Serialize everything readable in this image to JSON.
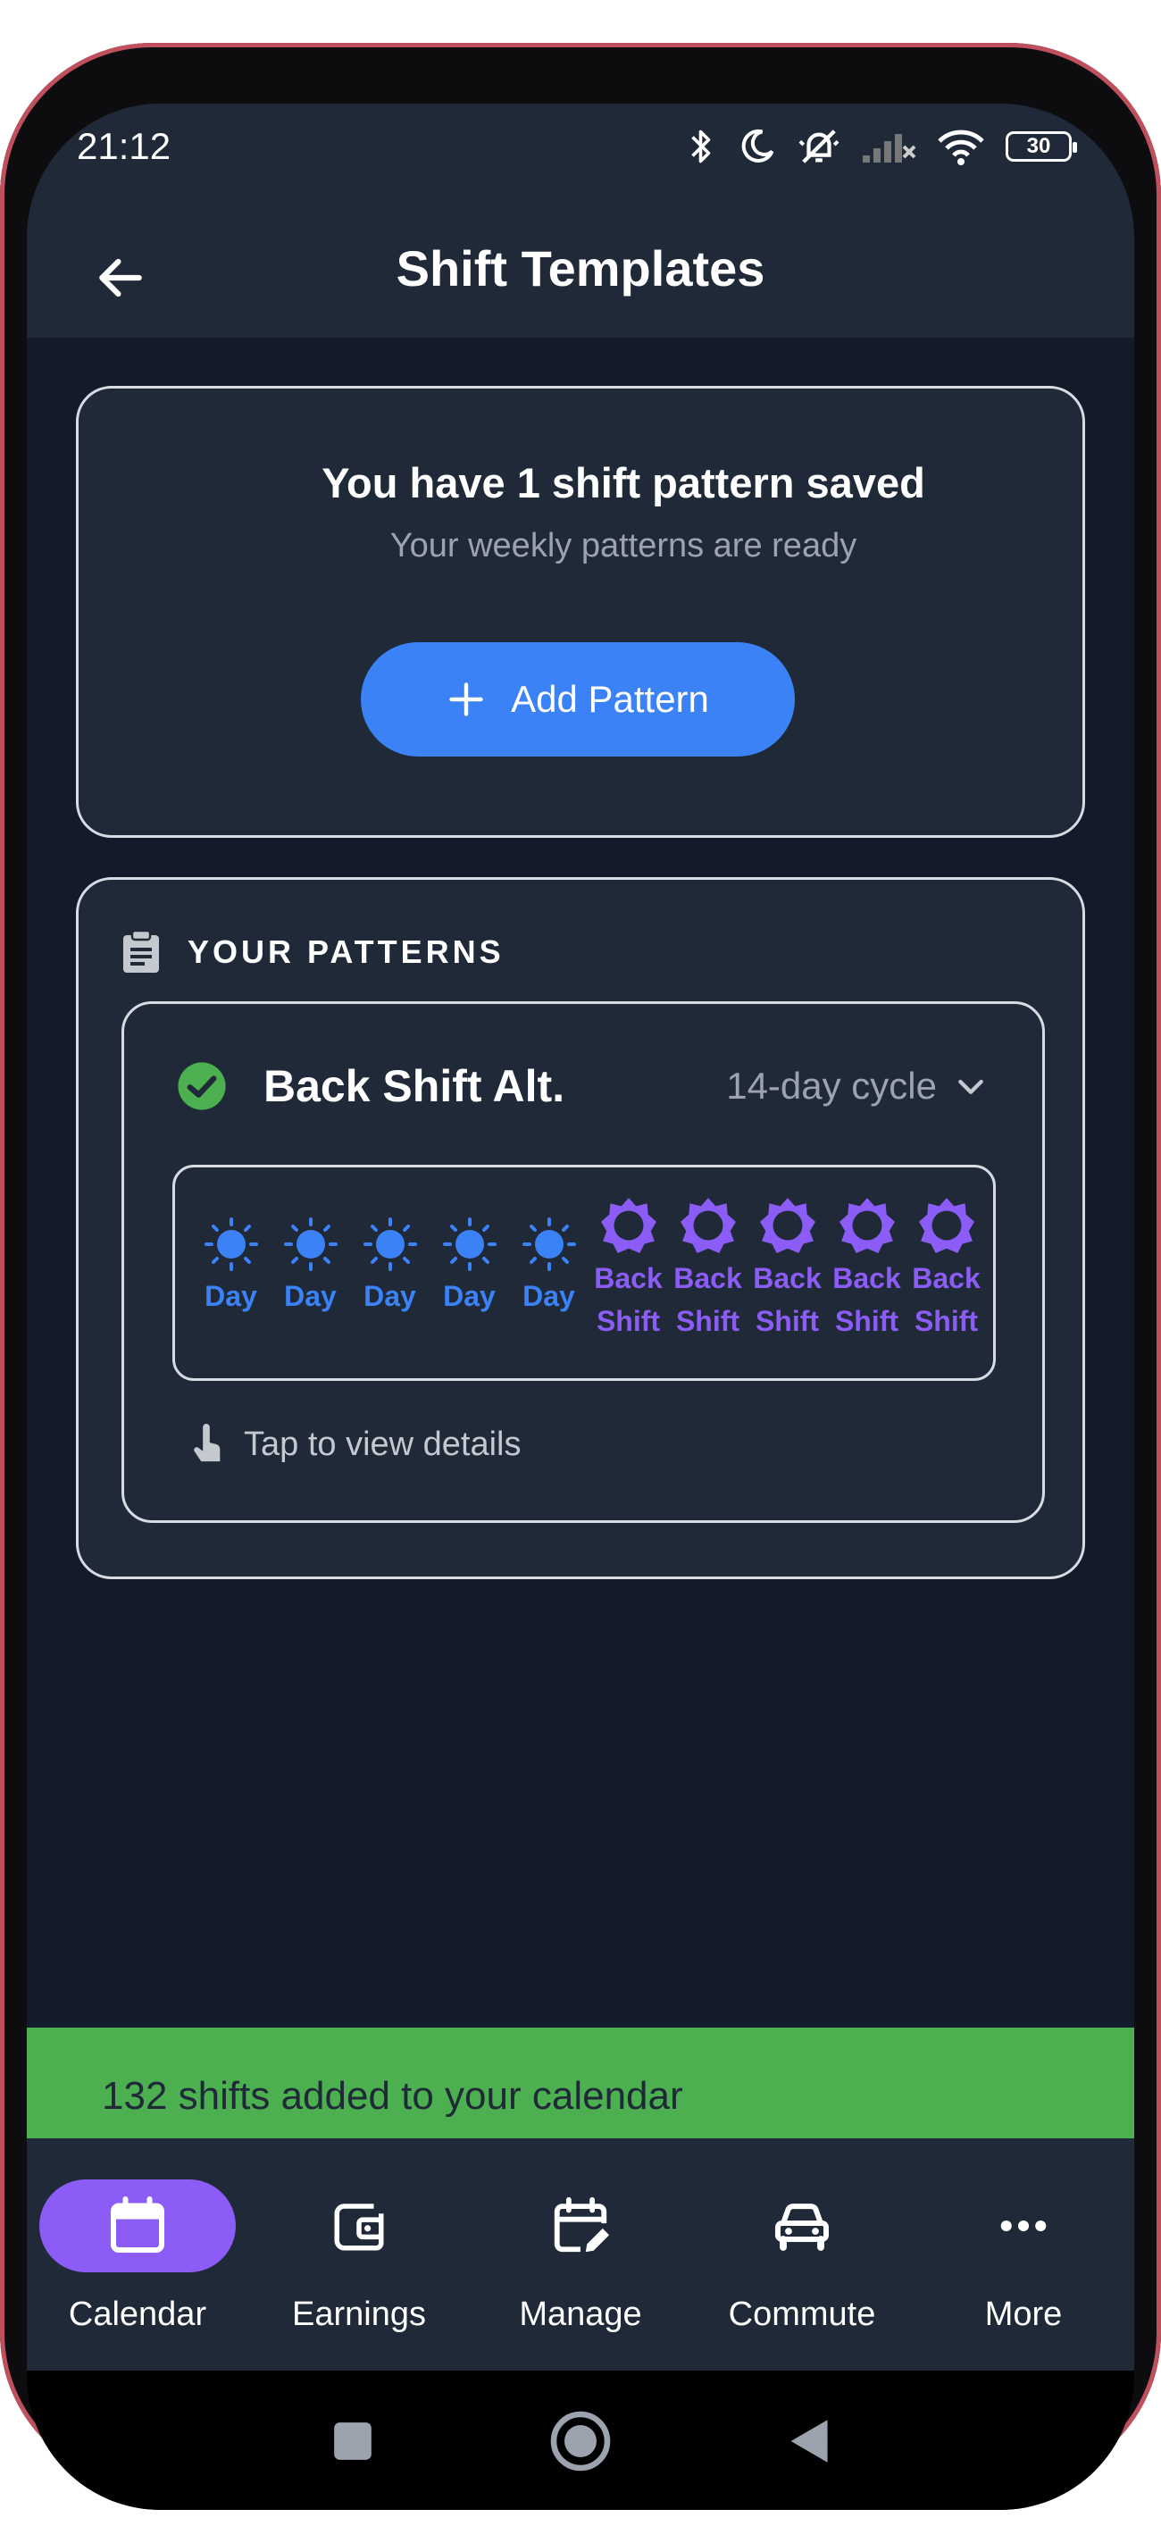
{
  "status_bar": {
    "time": "21:12",
    "battery": "30"
  },
  "app_bar": {
    "title": "Shift Templates",
    "back_icon": "arrow-left-icon"
  },
  "summary": {
    "title": "You have 1 shift pattern saved",
    "subtitle": "Your weekly patterns are ready",
    "add_button_label": "Add Pattern"
  },
  "patterns_section": {
    "title": "YOUR PATTERNS",
    "icon": "clipboard-icon",
    "patterns": [
      {
        "name": "Back Shift Alt.",
        "cycle": "14-day cycle",
        "days": [
          {
            "type": "day",
            "label": "Day",
            "icon": "sun-icon"
          },
          {
            "type": "day",
            "label": "Day",
            "icon": "sun-icon"
          },
          {
            "type": "day",
            "label": "Day",
            "icon": "sun-icon"
          },
          {
            "type": "day",
            "label": "Day",
            "icon": "sun-icon"
          },
          {
            "type": "day",
            "label": "Day",
            "icon": "sun-icon"
          },
          {
            "type": "back",
            "label_line1": "Back",
            "label_line2": "Shift",
            "icon": "brightness-icon"
          },
          {
            "type": "back",
            "label_line1": "Back",
            "label_line2": "Shift",
            "icon": "brightness-icon"
          },
          {
            "type": "back",
            "label_line1": "Back",
            "label_line2": "Shift",
            "icon": "brightness-icon"
          },
          {
            "type": "back",
            "label_line1": "Back",
            "label_line2": "Shift",
            "icon": "brightness-icon"
          },
          {
            "type": "back",
            "label_line1": "Back",
            "label_line2": "Shift",
            "icon": "brightness-icon"
          }
        ],
        "hint": "Tap to view details"
      }
    ]
  },
  "snackbar": {
    "message": "132 shifts added to your calendar"
  },
  "bottom_nav": {
    "items": [
      {
        "label": "Calendar",
        "icon": "calendar-icon",
        "active": true
      },
      {
        "label": "Earnings",
        "icon": "wallet-icon",
        "active": false
      },
      {
        "label": "Manage",
        "icon": "calendar-edit-icon",
        "active": false
      },
      {
        "label": "Commute",
        "icon": "car-icon",
        "active": false
      },
      {
        "label": "More",
        "icon": "more-horizontal-icon",
        "active": false
      }
    ]
  },
  "colors": {
    "accent_blue": "#3b82f6",
    "accent_purple": "#8b5cf6",
    "success_green": "#4caf50",
    "surface": "#1f2937",
    "background": "#131a2a"
  }
}
